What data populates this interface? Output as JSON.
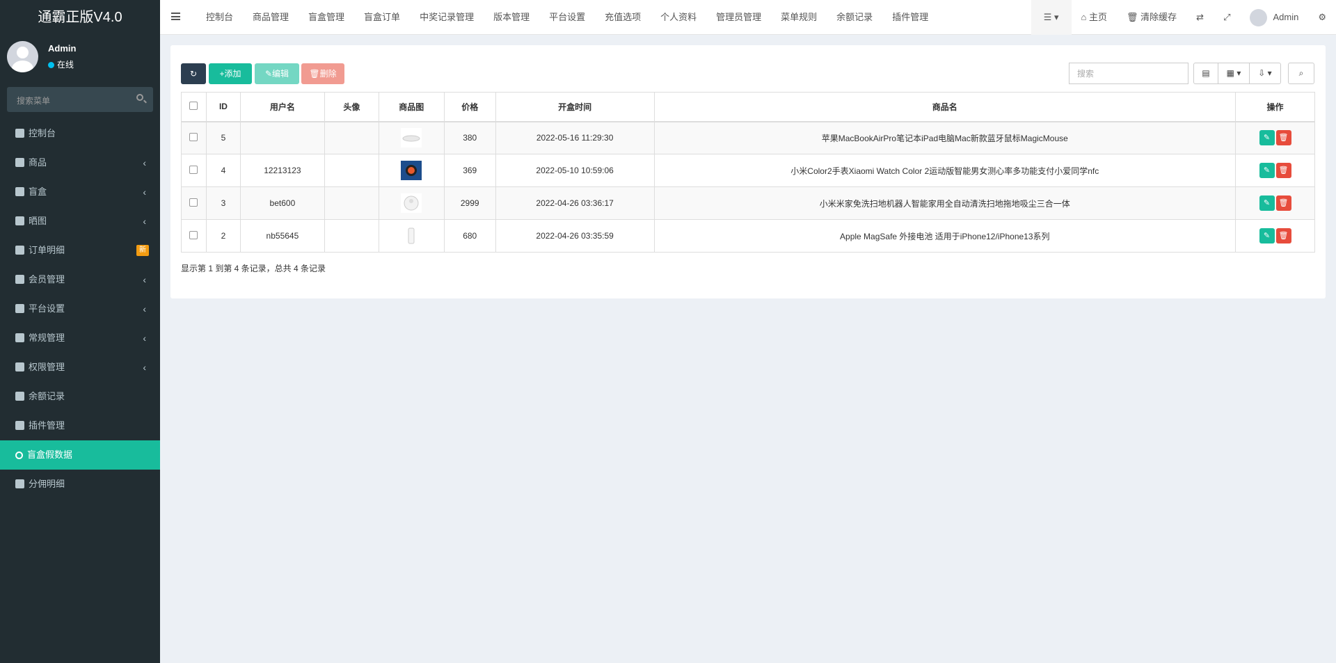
{
  "app": {
    "logo": "通霸正版V4.0"
  },
  "user": {
    "name": "Admin",
    "status": "在线"
  },
  "sidebar": {
    "search_placeholder": "搜索菜单",
    "items": [
      {
        "label": "控制台",
        "icon": "dashboard-icon",
        "has_arrow": false
      },
      {
        "label": "商品",
        "icon": "bag-icon",
        "has_arrow": true
      },
      {
        "label": "盲盒",
        "icon": "cube-icon",
        "has_arrow": true
      },
      {
        "label": "晒图",
        "icon": "dropbox-icon",
        "has_arrow": true
      },
      {
        "label": "订单明细",
        "icon": "cart-icon",
        "has_arrow": false,
        "badge": "新"
      },
      {
        "label": "会员管理",
        "icon": "list-icon",
        "has_arrow": true
      },
      {
        "label": "平台设置",
        "icon": "gear-icon",
        "has_arrow": true
      },
      {
        "label": "常规管理",
        "icon": "database-icon",
        "has_arrow": true
      },
      {
        "label": "权限管理",
        "icon": "users-icon",
        "has_arrow": true
      },
      {
        "label": "余额记录",
        "icon": "yen-icon",
        "has_arrow": false
      },
      {
        "label": "插件管理",
        "icon": "rocket-icon",
        "has_arrow": false
      },
      {
        "label": "盲盒假数据",
        "icon": "circle-icon",
        "has_arrow": false,
        "active": true
      },
      {
        "label": "分佣明细",
        "icon": "users-icon",
        "has_arrow": false
      }
    ]
  },
  "topnav": {
    "items": [
      "控制台",
      "商品管理",
      "盲盒管理",
      "盲盒订单",
      "中奖记录管理",
      "版本管理",
      "平台设置",
      "充值选项",
      "个人资料",
      "管理员管理",
      "菜单规则",
      "余额记录",
      "插件管理"
    ],
    "home": "主页",
    "clear_cache": "清除缓存",
    "admin": "Admin"
  },
  "toolbar": {
    "add": "添加",
    "edit": "编辑",
    "delete": "删除",
    "search_placeholder": "搜索"
  },
  "table": {
    "headers": [
      "ID",
      "用户名",
      "头像",
      "商品图",
      "价格",
      "开盒时间",
      "商品名",
      "操作"
    ],
    "rows": [
      {
        "id": "5",
        "username": "",
        "price": "380",
        "time": "2022-05-16 11:29:30",
        "product": "苹果MacBookAirPro笔记本iPad电脑Mac新款蓝牙鼠标MagicMouse",
        "thumb": "mouse"
      },
      {
        "id": "4",
        "username": "12213123",
        "price": "369",
        "time": "2022-05-10 10:59:06",
        "product": "小米Color2手表Xiaomi Watch Color 2运动版智能男女测心率多功能支付小爱同学nfc",
        "thumb": "watch"
      },
      {
        "id": "3",
        "username": "bet600",
        "price": "2999",
        "time": "2022-04-26 03:36:17",
        "product": "小米米家免洗扫地机器人智能家用全自动清洗扫地拖地吸尘三合一体",
        "thumb": "robot"
      },
      {
        "id": "2",
        "username": "nb55645",
        "price": "680",
        "time": "2022-04-26 03:35:59",
        "product": "Apple MagSafe 外接电池 适用于iPhone12/iPhone13系列",
        "thumb": "battery"
      }
    ],
    "summary": "显示第 1 到第 4 条记录，总共 4 条记录"
  }
}
